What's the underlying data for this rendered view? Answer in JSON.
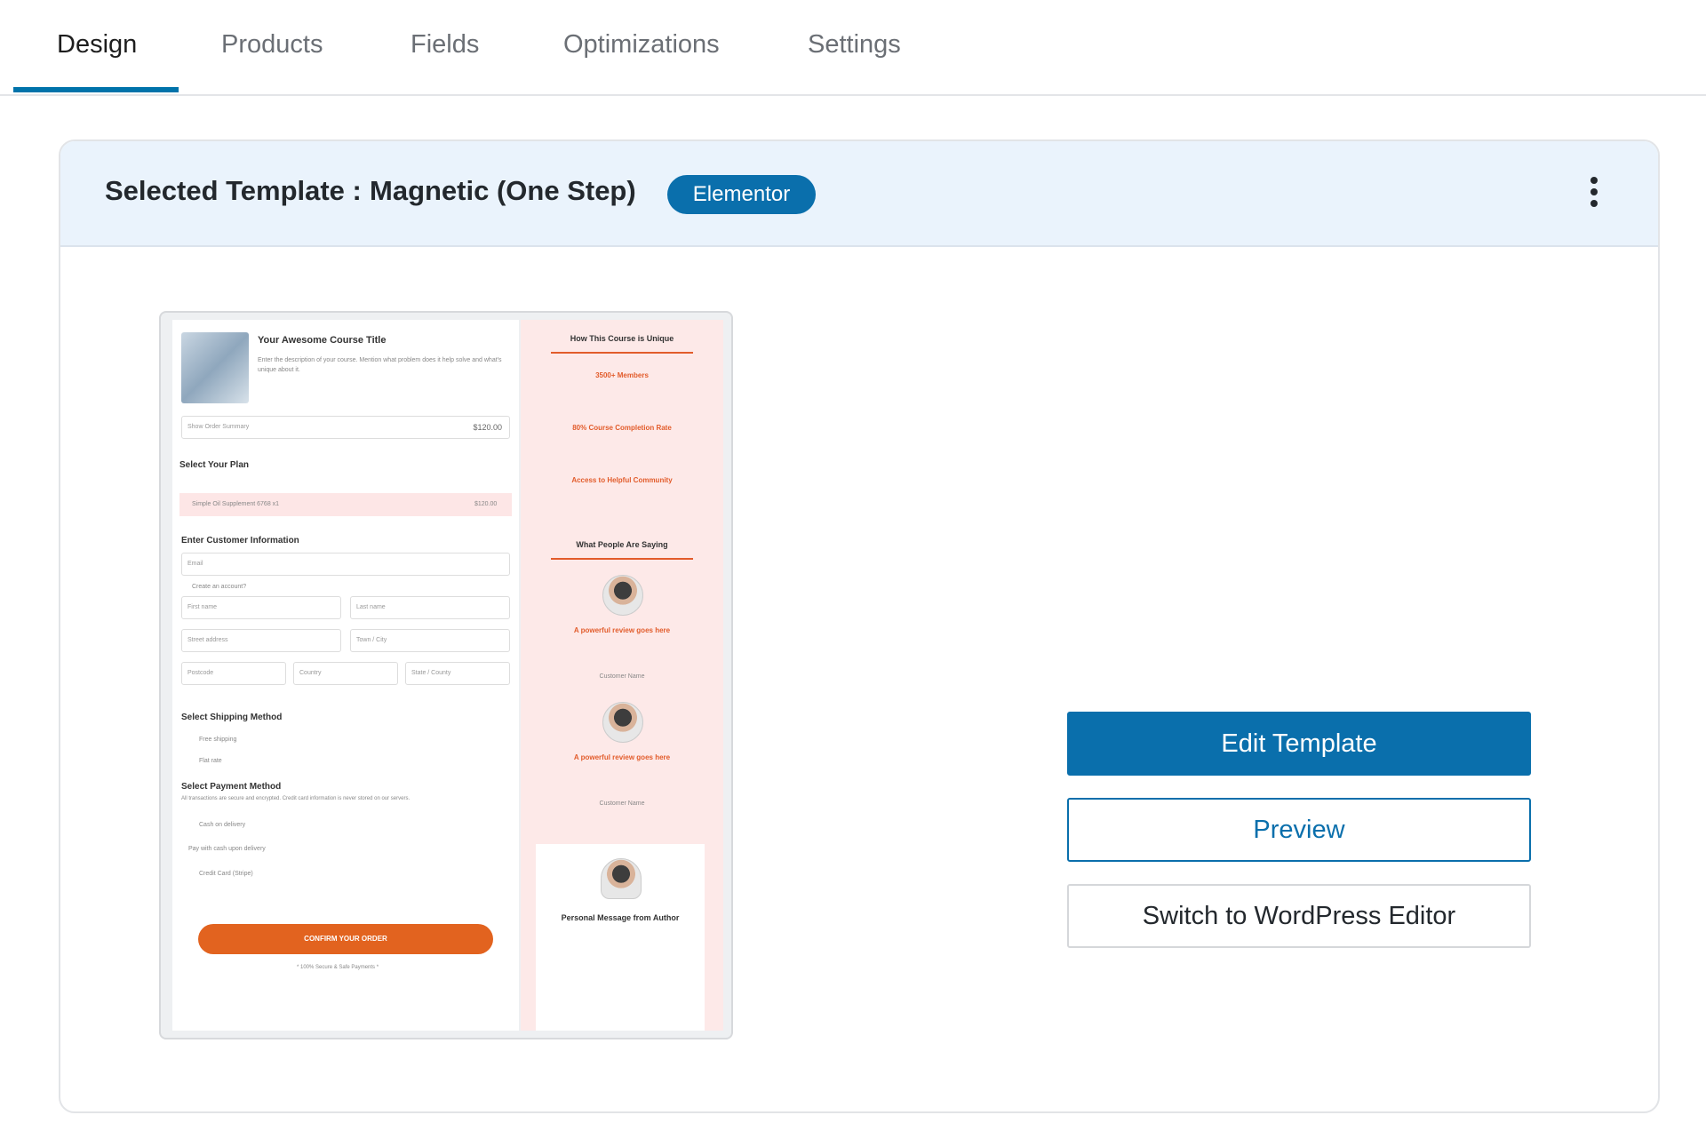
{
  "tabs": [
    {
      "label": "Design",
      "active": true
    },
    {
      "label": "Products"
    },
    {
      "label": "Fields"
    },
    {
      "label": "Optimizations"
    },
    {
      "label": "Settings"
    }
  ],
  "header": {
    "title": "Selected Template :",
    "template_name": "Magnetic  (One Step)",
    "badge": "Elementor",
    "menu_icon": "kebab-menu-icon"
  },
  "thumbnail": {
    "course_title": "Your Awesome Course Title",
    "course_desc": "Enter the description of your course. Mention what problem does it help solve and what's unique about it.",
    "order_summary": "Show Order Summary",
    "order_total": "$120.00",
    "select_plan": "Select Your Plan",
    "plan_item": "Simple Oil Supplement 6768 x1",
    "plan_price": "$120.00",
    "customer_info": "Enter Customer Information",
    "email": "Email",
    "create_account": "Create an account?",
    "first_name": "First name",
    "last_name": "Last name",
    "street": "Street address",
    "town": "Town / City",
    "postcode": "Postcode",
    "country": "Country",
    "state": "State / County",
    "shipping": "Select Shipping Method",
    "free_shipping": "Free shipping",
    "flat_rate": "Flat rate",
    "payment": "Select Payment Method",
    "payment_note": "All transactions are secure and encrypted. Credit card information is never stored on our servers.",
    "cod": "Cash on delivery",
    "cod_note": "Pay with cash upon delivery",
    "credit_card": "Credit Card (Stripe)",
    "cta": "CONFIRM YOUR ORDER",
    "secure": "* 100% Secure & Safe Payments *",
    "unique_heading": "How This Course is Unique",
    "members": "3500+ Members",
    "completion": "80% Course Completion Rate",
    "community": "Access to Helpful Community",
    "saying": "What People Are Saying",
    "review1": "A powerful review goes here",
    "review2": "A powerful review goes here",
    "customer_name": "Customer Name",
    "author_msg": "Personal Message from Author"
  },
  "actions": {
    "edit": "Edit Template",
    "preview": "Preview",
    "switch": "Switch to WordPress Editor"
  },
  "colors": {
    "accent": "#0a6fac",
    "header_bg": "#eaf3fc",
    "cta_orange": "#e2631f"
  }
}
